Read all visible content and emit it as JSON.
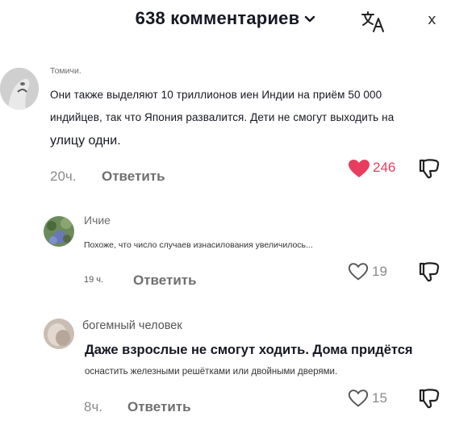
{
  "header": {
    "title": "638 комментариев",
    "close_label": "x"
  },
  "comments": [
    {
      "username": "Томичи.",
      "text_lines": [
        "Они также выделяют 10 триллионов иен Индии на приём 50 000",
        "индийцев, так что Япония развалится. Дети не смогут выходить на",
        "улицу одни."
      ],
      "time": "20ч.",
      "reply_label": "Ответить",
      "likes": "246",
      "liked": true
    },
    {
      "username": "Ичие",
      "text_lines": [
        "Похоже, что число случаев изнасилования увеличилось..."
      ],
      "time": "19 ч.",
      "reply_label": "Ответить",
      "likes": "19",
      "liked": false
    },
    {
      "username": "богемный человек",
      "text_lines": [
        "Даже взрослые не смогут ходить. Дома придётся",
        "оснастить железными решётками или двойными дверями."
      ],
      "time": "8ч.",
      "reply_label": "Ответить",
      "likes": "15",
      "liked": false
    }
  ],
  "colors": {
    "like_active": "#e83d5f",
    "text": "#161823",
    "muted": "#8a8a8a"
  },
  "icons": [
    "chevron-down-icon",
    "translate-icon",
    "close-icon",
    "heart-icon",
    "dislike-icon"
  ]
}
